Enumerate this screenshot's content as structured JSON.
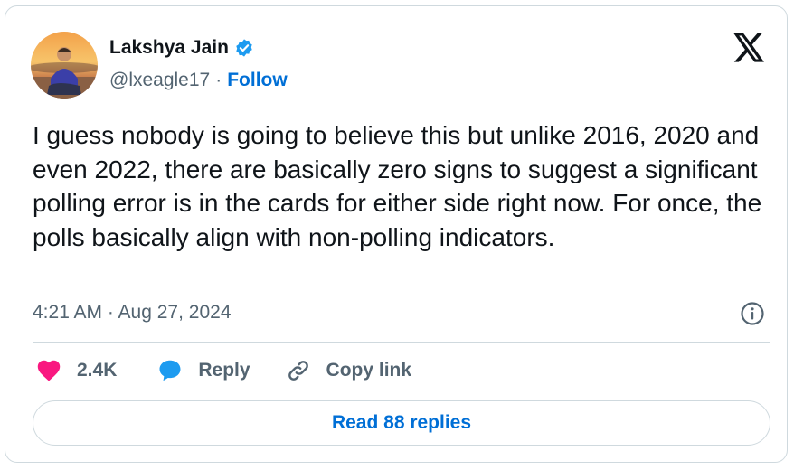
{
  "author": {
    "name": "Lakshya Jain",
    "handle": "@lxeagle17",
    "separator": "·",
    "follow_label": "Follow",
    "verified": true
  },
  "tweet": {
    "text": "I guess nobody is going to believe this but unlike 2016, 2020 and even 2022, there are basically zero signs to suggest a significant polling error is in the cards for either side right now. For once, the polls basically align with non-polling indicators.",
    "timestamp": "4:21 AM · Aug 27, 2024"
  },
  "actions": {
    "like_count": "2.4K",
    "reply_label": "Reply",
    "copy_label": "Copy link"
  },
  "read_replies_label": "Read 88 replies",
  "icons": [
    "verified-badge-icon",
    "x-logo-icon",
    "info-icon",
    "heart-icon",
    "reply-bubble-icon",
    "link-icon"
  ],
  "colors": {
    "text": "#0f1419",
    "secondary": "#536471",
    "link": "#006fd6",
    "verified": "#1d9bf0",
    "like": "#f91880",
    "border": "#cfd9de"
  }
}
